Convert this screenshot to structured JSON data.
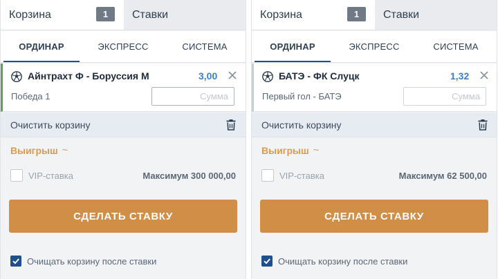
{
  "panels": [
    {
      "tabs": {
        "cart_label": "Корзина",
        "cart_count": "1",
        "bets_label": "Ставки"
      },
      "bet_types": [
        "ОРДИНАР",
        "ЭКСПРЕСС",
        "СИСТЕМА"
      ],
      "event": {
        "match": "Айнтрахт Ф - Боруссия М",
        "odds": "3,00",
        "market": "Победа 1",
        "stake_placeholder": "Сумма"
      },
      "clear_label": "Очистить корзину",
      "winnings_label": "Выигрыш",
      "winnings_value": "~",
      "vip_label": "VIP-ставка",
      "max_label": "Максимум 300 000,00",
      "make_bet_label": "СДЕЛАТЬ СТАВКУ",
      "clear_after_label": "Очищать корзину после ставки"
    },
    {
      "tabs": {
        "cart_label": "Корзина",
        "cart_count": "1",
        "bets_label": "Ставки"
      },
      "bet_types": [
        "ОРДИНАР",
        "ЭКСПРЕСС",
        "СИСТЕМА"
      ],
      "event": {
        "match": "БАТЭ - ФК Слуцк",
        "odds": "1,32",
        "market": "Первый гол - БАТЭ",
        "stake_placeholder": "Сумма"
      },
      "clear_label": "Очистить корзину",
      "winnings_label": "Выигрыш",
      "winnings_value": "~",
      "vip_label": "VIP-ставка",
      "max_label": "Максимум 62 500,00",
      "make_bet_label": "СДЕЛАТЬ СТАВКУ",
      "clear_after_label": "Очищать корзину после ставки"
    }
  ],
  "colors": {
    "accent_button": "#d08e46",
    "winnings": "#e09a4b",
    "odds": "#3d7fc1",
    "active_tab_underline": "#1e4f8e",
    "selected_event_border": "#5aa15b"
  },
  "icons": [
    "soccer-ball-icon",
    "close-icon",
    "trash-icon",
    "checkmark-icon"
  ]
}
